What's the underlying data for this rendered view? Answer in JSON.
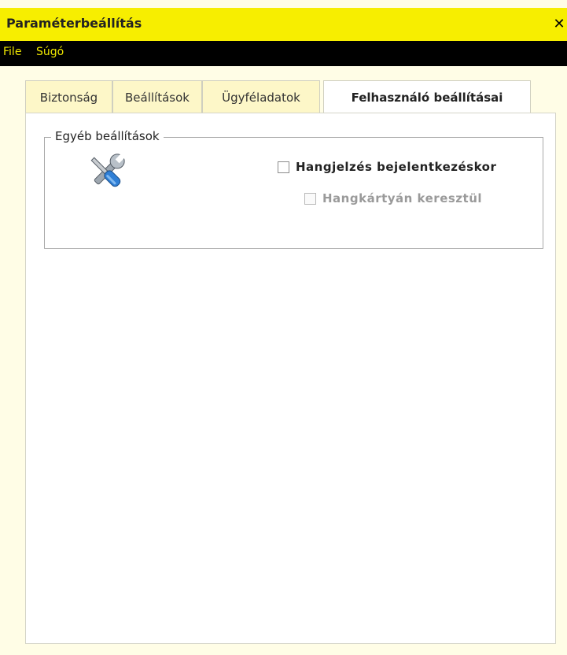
{
  "window": {
    "title": "Paraméterbeállítás",
    "close_symbol": "✕"
  },
  "menu": {
    "items": [
      {
        "label": "File"
      },
      {
        "label": "Súgó"
      }
    ]
  },
  "tabs": [
    {
      "label": "Biztonság",
      "active": false
    },
    {
      "label": "Beállítások",
      "active": false
    },
    {
      "label": "Ügyféladatok",
      "active": false
    },
    {
      "label": "Felhasználó beállításai",
      "active": true
    }
  ],
  "group": {
    "legend": "Egyéb beállítások",
    "icon": "tools-icon",
    "options": [
      {
        "label": "Hangjelzés bejelentkezéskor",
        "checked": false,
        "enabled": true
      },
      {
        "label": "Hangkártyán keresztül",
        "checked": false,
        "enabled": false
      }
    ]
  },
  "colors": {
    "titlebar": "#f7ee00",
    "menubar": "#000000",
    "menu_text": "#f0e800",
    "tab_bg": "#fdf7c8",
    "background": "#fffde6"
  }
}
